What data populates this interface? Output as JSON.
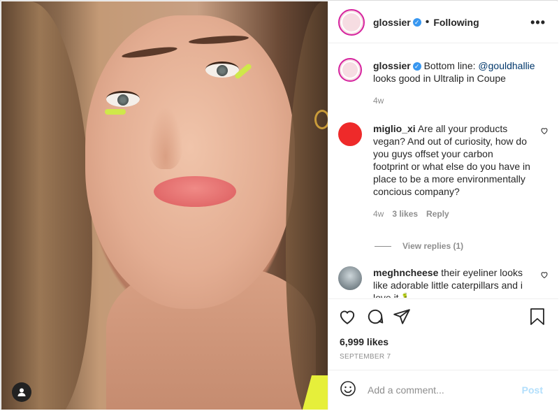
{
  "post": {
    "author": "glossier",
    "follow_status": "Following",
    "more_icon": "ellipsis-icon",
    "caption_text": "Bottom line: ",
    "caption_mention": "@gouldhallie",
    "caption_rest": " looks good in Ultralip in Coupe",
    "caption_age": "4w",
    "likes": "6,999 likes",
    "date": "SEPTEMBER 7"
  },
  "comments": [
    {
      "user": "miglio_xi",
      "text": "Are all your products vegan? And out of curiosity, how do you guys offset your carbon footprint or what else do you have in place to be a more environmentally concious company?",
      "age": "4w",
      "likes": "3 likes",
      "reply": "Reply",
      "view_replies": "View replies (1)",
      "avatar_color": "#ee2a2a"
    },
    {
      "user": "meghncheese",
      "text": "their eyeliner looks like adorable little caterpillars and i love it 🐛"
    }
  ],
  "composer": {
    "placeholder": "Add a comment...",
    "post_label": "Post"
  },
  "colors": {
    "accent": "#3897f0",
    "post_disabled": "#b2dffc",
    "story_ring": "#d6249f"
  }
}
